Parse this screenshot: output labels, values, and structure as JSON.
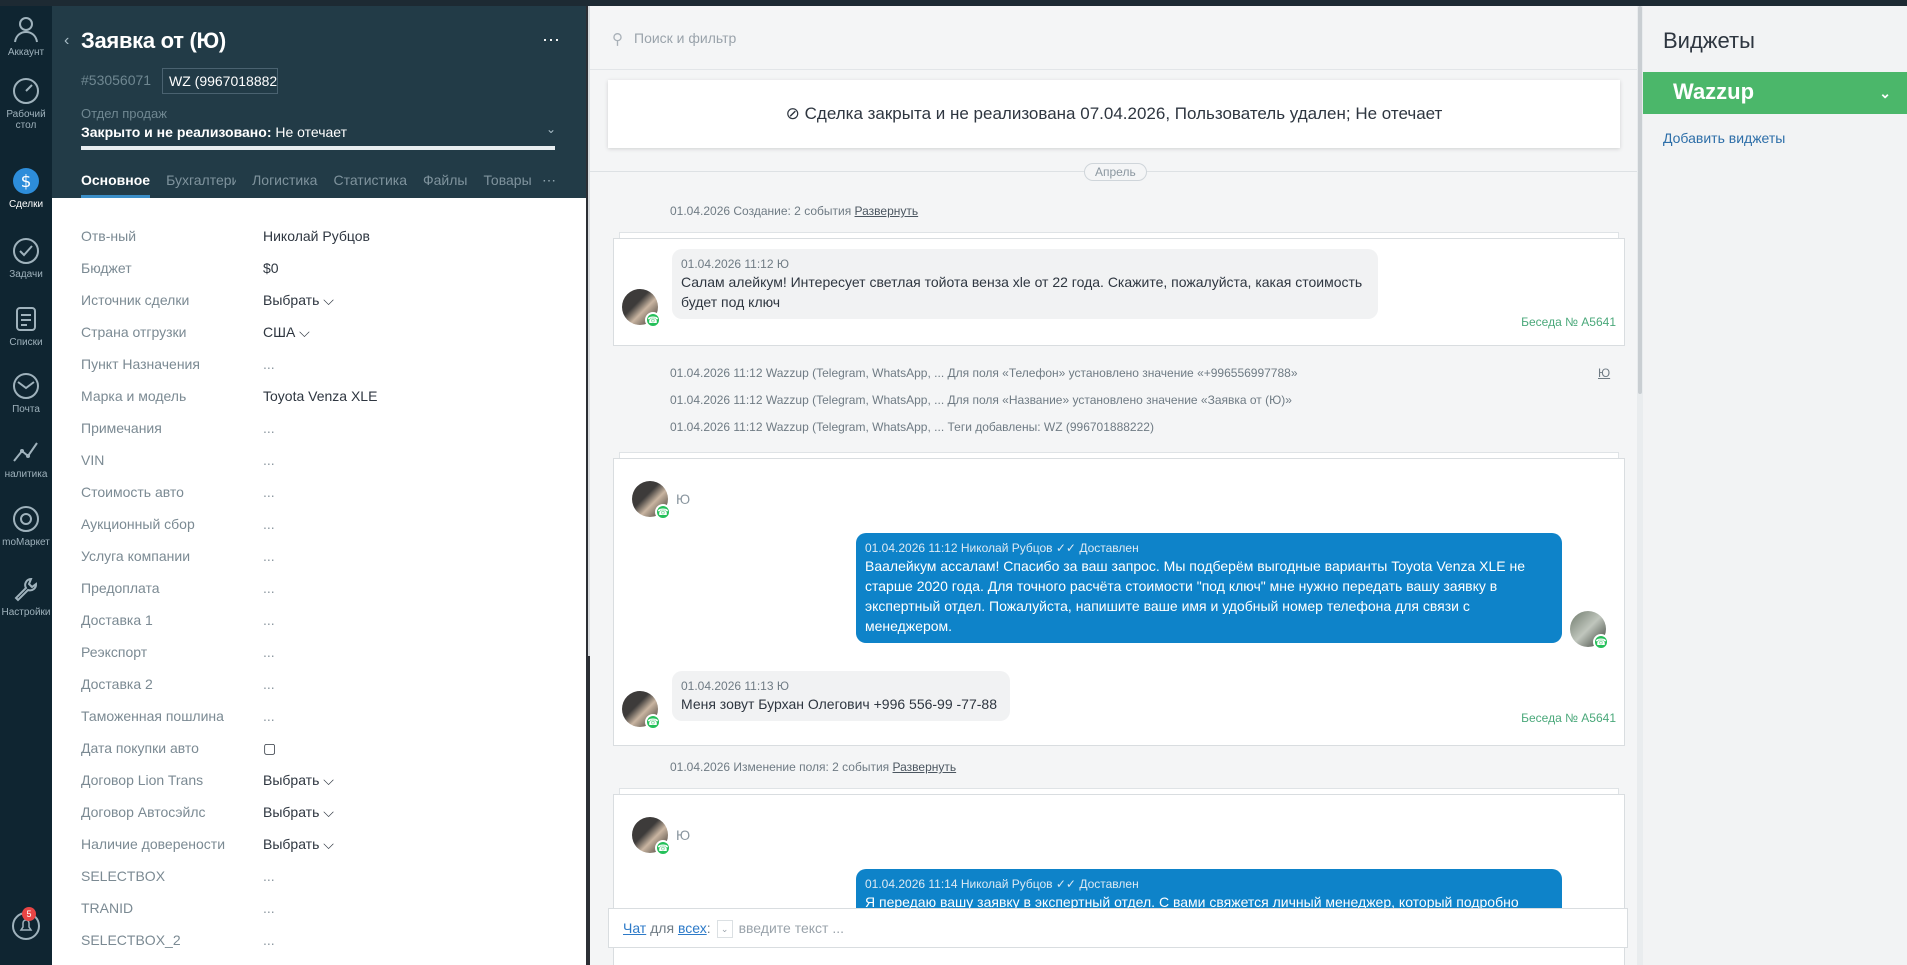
{
  "nav": [
    {
      "label": "Аккаунт",
      "icon": "account-icon"
    },
    {
      "label": "Рабочий стол",
      "icon": "dashboard-icon"
    },
    {
      "label": "Сделки",
      "icon": "deals-icon"
    },
    {
      "label": "Задачи",
      "icon": "tasks-icon"
    },
    {
      "label": "Списки",
      "icon": "lists-icon"
    },
    {
      "label": "Почта",
      "icon": "mail-icon"
    },
    {
      "label": "налитика",
      "icon": "analytics-icon"
    },
    {
      "label": "moМаркет",
      "icon": "market-icon"
    },
    {
      "label": "Настройки",
      "icon": "settings-icon"
    }
  ],
  "notifications": {
    "count": "5"
  },
  "lead": {
    "title": "Заявка от (Ю)",
    "id": "#53056071",
    "tag": "WZ (996701888222)",
    "pipeline": "Отдел продаж",
    "status_label": "Закрыто и не реализовано:",
    "status_reason": " Не отечает",
    "tabs": [
      "Основное",
      "Бухгалтерия",
      "Логистика",
      "Статистика",
      "Файлы",
      "Товары"
    ],
    "fields": [
      {
        "label": "Отв-ный",
        "value": "Николай Рубцов"
      },
      {
        "label": "Бюджет",
        "value": "$0"
      },
      {
        "label": "Источник сделки",
        "value": "Выбрать ⌵"
      },
      {
        "label": "Страна отгрузки",
        "value": "США ⌵"
      },
      {
        "label": "Пункт Назначения",
        "value": "..."
      },
      {
        "label": "Марка и модель",
        "value": "Toyota Venza XLE"
      },
      {
        "label": "Примечания",
        "value": "..."
      },
      {
        "label": "VIN",
        "value": "..."
      },
      {
        "label": "Стоимость авто",
        "value": "..."
      },
      {
        "label": "Аукционный сбор",
        "value": "..."
      },
      {
        "label": "Услуга компании",
        "value": "..."
      },
      {
        "label": "Предоплата",
        "value": "..."
      },
      {
        "label": "Доставка 1",
        "value": "..."
      },
      {
        "label": "Реэкспорт",
        "value": "..."
      },
      {
        "label": "Доставка 2",
        "value": "..."
      },
      {
        "label": "Таможенная пошлина",
        "value": "..."
      },
      {
        "label": "Дата покупки авто",
        "value": "▢"
      },
      {
        "label": "Договор Lion Trans",
        "value": "Выбрать ⌵"
      },
      {
        "label": "Договор Автосэйлс",
        "value": "Выбрать ⌵"
      },
      {
        "label": "Наличие довереноcти",
        "value": "Выбрать ⌵"
      },
      {
        "label": "SELECTBOX",
        "value": "..."
      },
      {
        "label": "TRANID",
        "value": "..."
      },
      {
        "label": "SELECTBOX_2",
        "value": "..."
      }
    ]
  },
  "feed": {
    "search_placeholder": "Поиск и фильтр",
    "closed_notice": "Сделка закрыта и не реализована 07.04.2026, Пользователь удален; Не отечает",
    "month": "Апрель",
    "events": [
      {
        "text": "01.04.2026 Создание: 2 события ",
        "link": "Развернуть"
      },
      {
        "text": "01.04.2026 11:12 Wazzup (Telegram, WhatsApp, ... Для поля «Телефон» установлено значение «+996556997788»"
      },
      {
        "text": "01.04.2026 11:12 Wazzup (Telegram, WhatsApp, ... Для поля «Название» установлено значение «Заявка от (Ю)»"
      },
      {
        "text": "01.04.2026 11:12 Wazzup (Telegram, WhatsApp, ... Теги добавлены: WZ (996701888222)"
      },
      {
        "text": "01.04.2026 Изменение поля: 2 события ",
        "link": "Развернуть"
      }
    ],
    "event_author_link": "Ю",
    "msg1": {
      "meta": "01.04.2026 11:12 Ю",
      "text": "Салам алейкум! Интересует светлая тойота венза xle от 22 года. Скажите, пожалуйста, какая стоимость будет под ключ"
    },
    "conversation": "Беседа № A5641",
    "sender": "Ю",
    "msg2": {
      "meta": "01.04.2026 11:12 Николай Рубцов  ✓✓ Доставлен",
      "text": "Ваалейкум ассалам! Спасибо за ваш запрос. Мы подберём выгодные варианты Toyota Venza XLE не старше 2020 года. Для точного расчёта стоимости \"под ключ\" мне нужно передать вашу заявку в экспертный отдел. Пожалуйста, напишите ваше имя и удобный номер телефона для связи с менеджером."
    },
    "msg3": {
      "meta": "01.04.2026 11:13 Ю",
      "text": "Меня зовут Бурхан Олегович +996 556-99 -77-88"
    },
    "msg4": {
      "meta": "01.04.2026 11:14 Николай Рубцов  ✓✓ Доставлен",
      "text": "Я передаю вашу заявку в экспертный отдел. С вами свяжется личный менеджер, который подробно"
    },
    "chat": {
      "chat": "Чат",
      "for": " для ",
      "all": "всех",
      "colon": ":",
      "placeholder": "введите текст ..."
    }
  },
  "widgets": {
    "title": "Виджеты",
    "wazzup": "Wazzup",
    "add": "Добавить виджеты"
  }
}
